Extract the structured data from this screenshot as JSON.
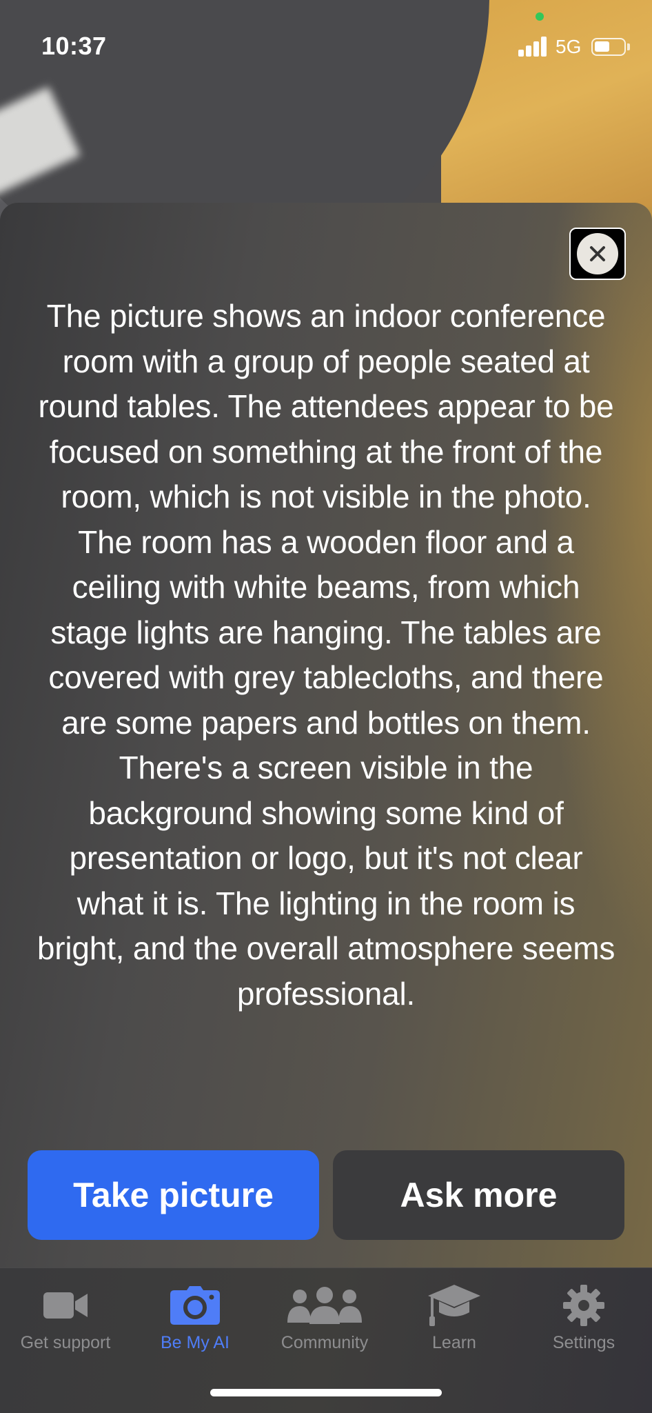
{
  "status_bar": {
    "time": "10:37",
    "network": "5G",
    "signal_bars": 4,
    "battery_level": 0.55
  },
  "result": {
    "close_label": "Close",
    "description": "The picture shows an indoor conference room with a group of people seated at round tables. The attendees appear to be focused on something at the front of the room, which is not visible in the photo. The room has a wooden floor and a ceiling with white beams, from which stage lights are hanging. The tables are covered with grey tablecloths, and there are some papers and bottles on them. There's a screen visible in the background showing some kind of presentation or logo, but it's not clear what it is. The lighting in the room is bright, and the overall atmosphere seems professional."
  },
  "actions": {
    "take_picture": "Take picture",
    "ask_more": "Ask more"
  },
  "tabs": [
    {
      "label": "Get support",
      "icon": "video-camera-icon",
      "active": false
    },
    {
      "label": "Be My AI",
      "icon": "camera-icon",
      "active": true
    },
    {
      "label": "Community",
      "icon": "people-icon",
      "active": false
    },
    {
      "label": "Learn",
      "icon": "graduation-cap-icon",
      "active": false
    },
    {
      "label": "Settings",
      "icon": "gear-icon",
      "active": false
    }
  ],
  "colors": {
    "accent": "#2f6af0",
    "active_tab": "#4f7df7",
    "inactive_tab": "#8e8e90"
  }
}
